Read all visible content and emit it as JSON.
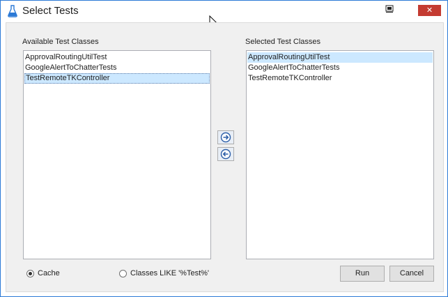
{
  "window": {
    "title": "Select Tests",
    "title_icon": "flask-icon",
    "close_label": "✕"
  },
  "available": {
    "label": "Available Test Classes",
    "items": [
      "ApprovalRoutingUtilTest",
      "GoogleAlertToChatterTests",
      "TestRemoteTKController"
    ]
  },
  "selected": {
    "label": "Selected Test Classes",
    "items": [
      "ApprovalRoutingUtilTest",
      "GoogleAlertToChatterTests",
      "TestRemoteTKController"
    ]
  },
  "transfer": {
    "add_icon": "arrow-right-icon",
    "remove_icon": "arrow-left-icon"
  },
  "options": {
    "cache_label": "Cache",
    "classes_like_label": "Classes LIKE '%Test%'",
    "selected_option": "Cache"
  },
  "actions": {
    "run_label": "Run",
    "cancel_label": "Cancel"
  },
  "colors": {
    "accent": "#2b79d6",
    "selection": "#cce8ff",
    "close": "#c43b31"
  }
}
